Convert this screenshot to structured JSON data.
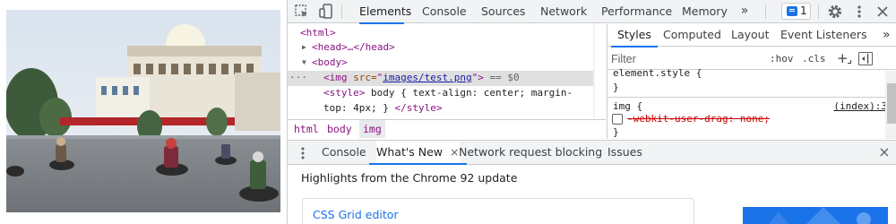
{
  "toolbar": {
    "tabs": [
      "Elements",
      "Console",
      "Sources",
      "Network",
      "Performance",
      "Memory"
    ],
    "more_tabs": "»",
    "issues_count": "1",
    "settings_icon": "gear-icon",
    "menu_icon": "kebab-menu-icon",
    "close_icon": "close-icon"
  },
  "tree": {
    "html_open": "<html>",
    "head": "<head>…</head>",
    "body_open": "<body>",
    "img_tag_open": "<img ",
    "img_attr_name": "src=",
    "img_attr_quote_open": "\"",
    "img_attr_value": "images/test.png",
    "img_attr_quote_close": "\"",
    "img_tag_close": ">",
    "selected_marker": "== $0",
    "dots": "···",
    "style_open": "<style>",
    "style_text1": " body { text-align: center; margin-",
    "style_text2": "top: 4px; } ",
    "style_close": "</style>"
  },
  "breadcrumb": [
    "html",
    "body",
    "img"
  ],
  "styles": {
    "tabs": [
      "Styles",
      "Computed",
      "Layout",
      "Event Listeners"
    ],
    "more_tabs": "»",
    "filter_placeholder": "Filter",
    "hov": ":hov",
    "cls": ".cls",
    "plus": "+",
    "rule1_selector": "element.style {",
    "rule1_close": "}",
    "rule2_selector": "img {",
    "rule2_source": "(index):3",
    "rule2_prop": "-webkit-user-drag: none;",
    "rule2_close": "}"
  },
  "drawer": {
    "tabs": [
      "Console",
      "What's New",
      "Network request blocking",
      "Issues"
    ],
    "active_close": "×",
    "close": "×",
    "highlight": "Highlights from the Chrome 92 update",
    "card_title": "CSS Grid editor"
  }
}
